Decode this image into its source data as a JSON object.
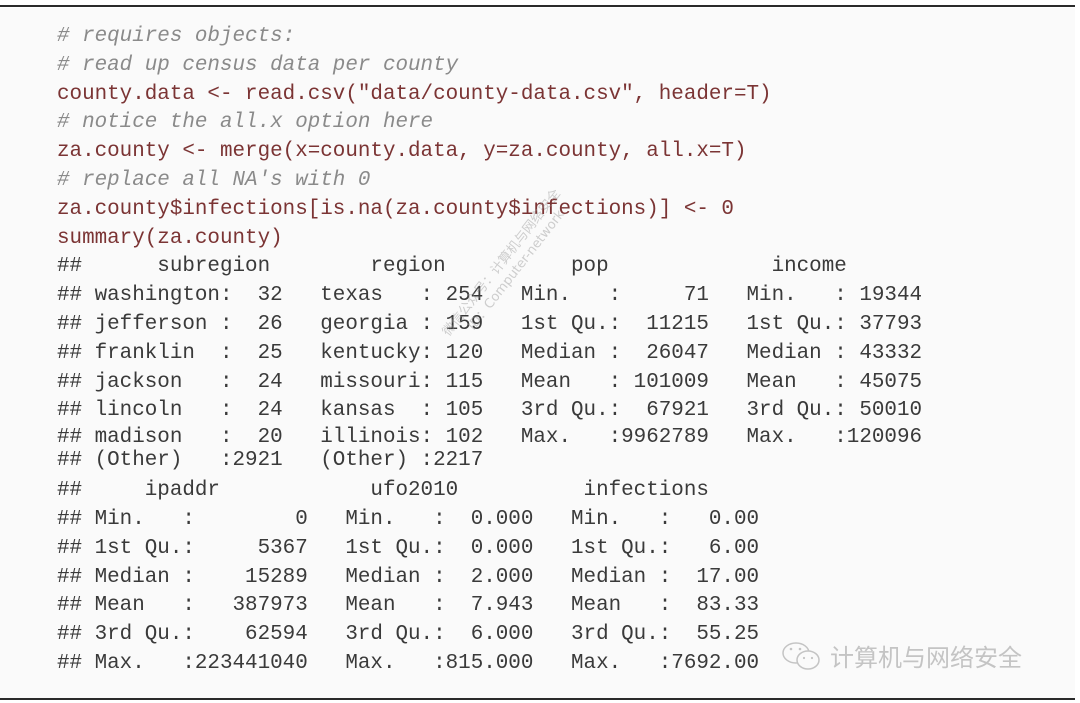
{
  "code": {
    "lines": [
      "# requires objects:",
      "# read up census data per county",
      "county.data <- read.csv(\"data/county-data.csv\", header=T)",
      "# notice the all.x option here",
      "za.county <- merge(x=county.data, y=za.county, all.x=T)",
      "# replace all NA's with 0",
      "za.county$infections[is.na(za.county$infections)] <- 0",
      "summary(za.county)"
    ]
  },
  "output": {
    "block1": [
      "##      subregion        region          pop             income",
      "## washington:  32   texas   : 254   Min.   :     71   Min.   : 19344",
      "## jefferson :  26   georgia : 159   1st Qu.:  11215   1st Qu.: 37793",
      "## franklin  :  25   kentucky: 120   Median :  26047   Median : 43332",
      "## jackson   :  24   missouri: 115   Mean   : 101009   Mean   : 45075",
      "## lincoln   :  24   kansas  : 105   3rd Qu.:  67921   3rd Qu.: 50010",
      "## madison   :  20   illinois: 102   Max.   :9962789   Max.   :120096",
      "## (Other)   :2921   (Other) :2217"
    ],
    "block2": [
      "##     ipaddr            ufo2010          infections",
      "## Min.   :        0   Min.   :  0.000   Min.   :   0.00",
      "## 1st Qu.:     5367   1st Qu.:  0.000   1st Qu.:   6.00",
      "## Median :    15289   Median :  2.000   Median :  17.00",
      "## Mean   :   387973   Mean   :  7.943   Mean   :  83.33",
      "## 3rd Qu.:    62594   3rd Qu.:  6.000   3rd Qu.:  55.25",
      "## Max.   :223441040   Max.   :815.000   Max.   :7692.00"
    ]
  },
  "watermark": {
    "icon": "wechat-icon",
    "text": "计算机与网络安全",
    "diagonal_line1": "微信公众号：计算机与网络安全",
    "diagonal_line2": "ID：Computer-network"
  },
  "colors": {
    "code": "#7b3434",
    "comment": "#8a8a8a",
    "output": "#3a3a3a"
  }
}
